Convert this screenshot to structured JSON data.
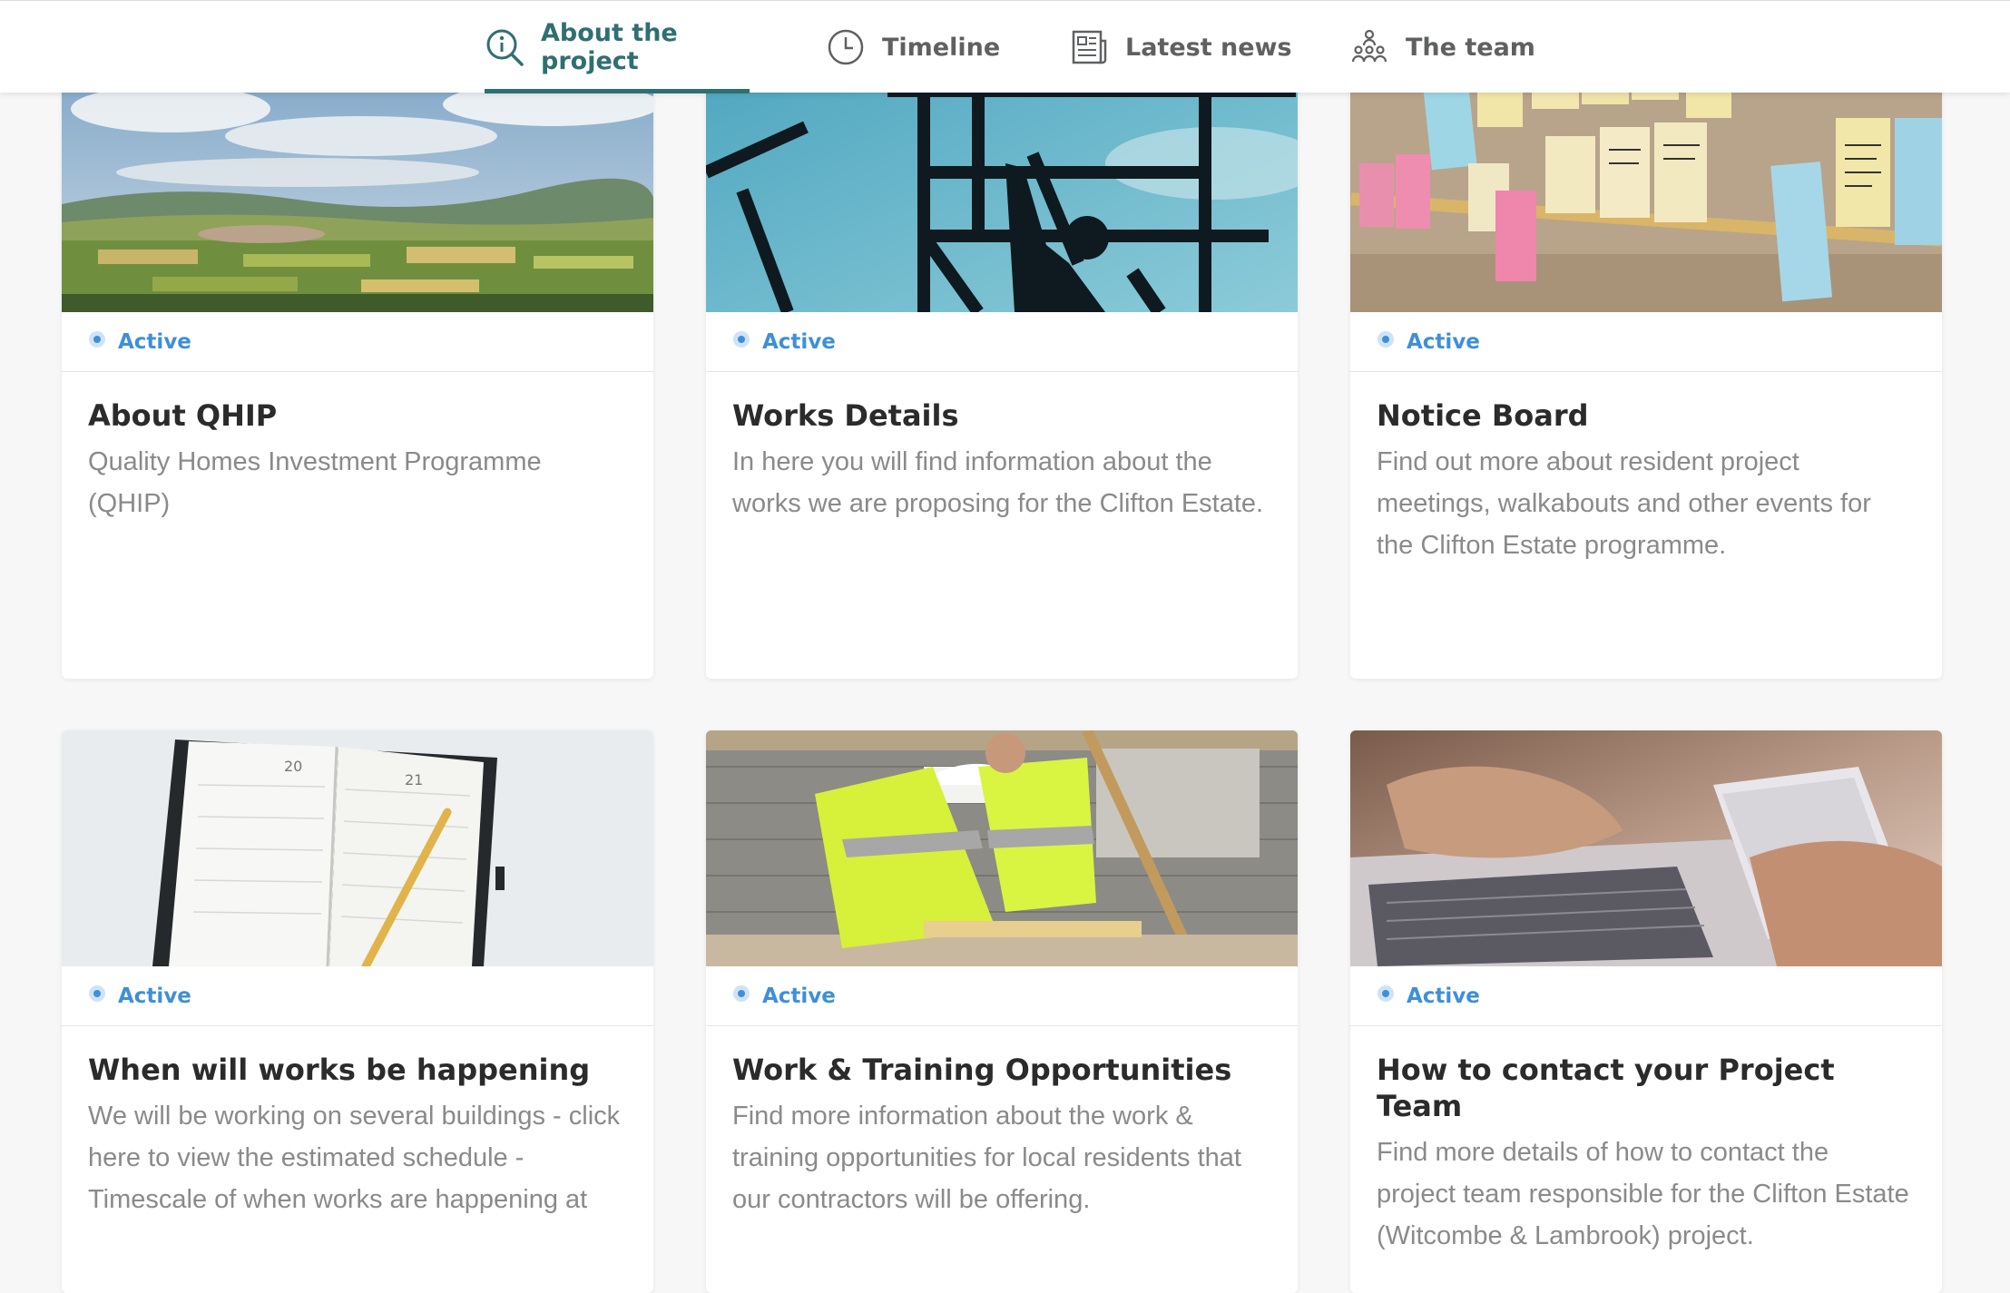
{
  "nav": {
    "tabs": [
      {
        "label": "About the project",
        "icon": "info-search-icon",
        "active": true
      },
      {
        "label": "Timeline",
        "icon": "clock-icon",
        "active": false
      },
      {
        "label": "Latest news",
        "icon": "newspaper-icon",
        "active": false
      },
      {
        "label": "The team",
        "icon": "team-icon",
        "active": false
      }
    ]
  },
  "colors": {
    "accent": "#2f6f72",
    "status": "#3f8fd8",
    "background": "#f7f7f7"
  },
  "cards": [
    {
      "status": "Active",
      "title": "About QHIP",
      "description": "Quality Homes Investment Programme (QHIP)",
      "image": "countryside-landscape"
    },
    {
      "status": "Active",
      "title": "Works Details",
      "description": "In here you will find information about the works we are proposing for the Clifton Estate.",
      "image": "scaffolding-worker"
    },
    {
      "status": "Active",
      "title": "Notice Board",
      "description": "Find out more about resident project meetings, walkabouts and other events for the Clifton Estate programme.",
      "image": "sticky-notes-board"
    },
    {
      "status": "Active",
      "title": "When will works be happening",
      "description": "We will be working on several buildings - click here to view the estimated schedule - Timescale of when works are happening at",
      "image": "diary-and-pencil"
    },
    {
      "status": "Active",
      "title": "Work & Training Opportunities",
      "description": "Find more information about the work & training opportunities for local residents that our contractors will be offering.",
      "image": "construction-workers"
    },
    {
      "status": "Active",
      "title": "How to contact your Project Team",
      "description": "Find more details of how to contact the project team responsible for the Clifton Estate (Witcombe & Lambrook) project.",
      "image": "laptop-and-phone"
    }
  ]
}
